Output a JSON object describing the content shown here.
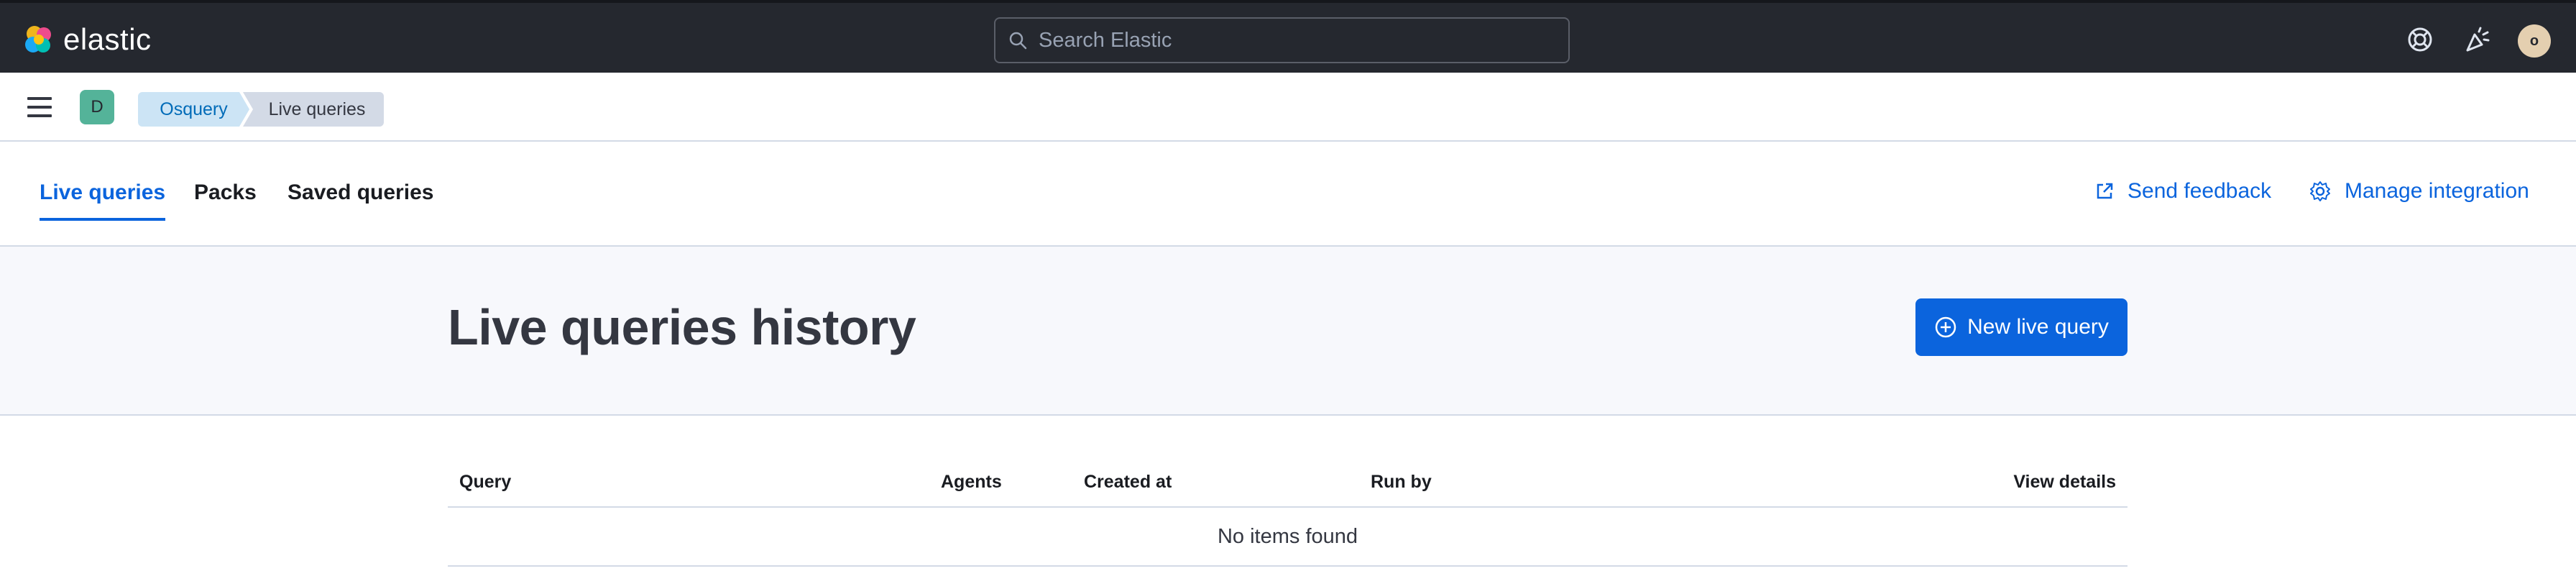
{
  "header": {
    "brand": "elastic",
    "search_placeholder": "Search Elastic",
    "user_initial": "o"
  },
  "subbar": {
    "space_initial": "D",
    "breadcrumbs": [
      "Osquery",
      "Live queries"
    ]
  },
  "tabs": [
    {
      "label": "Live queries",
      "active": true
    },
    {
      "label": "Packs",
      "active": false
    },
    {
      "label": "Saved queries",
      "active": false
    }
  ],
  "header_links": {
    "feedback": "Send feedback",
    "manage": "Manage integration"
  },
  "page": {
    "title": "Live queries history",
    "new_button": "New live query"
  },
  "table": {
    "columns": [
      "Query",
      "Agents",
      "Created at",
      "Run by",
      "View details"
    ],
    "empty_message": "No items found"
  },
  "colors": {
    "header_bg": "#25282f",
    "accent": "#0b64dd",
    "space_avatar": "#54b399",
    "user_avatar": "#e4cfb0"
  }
}
